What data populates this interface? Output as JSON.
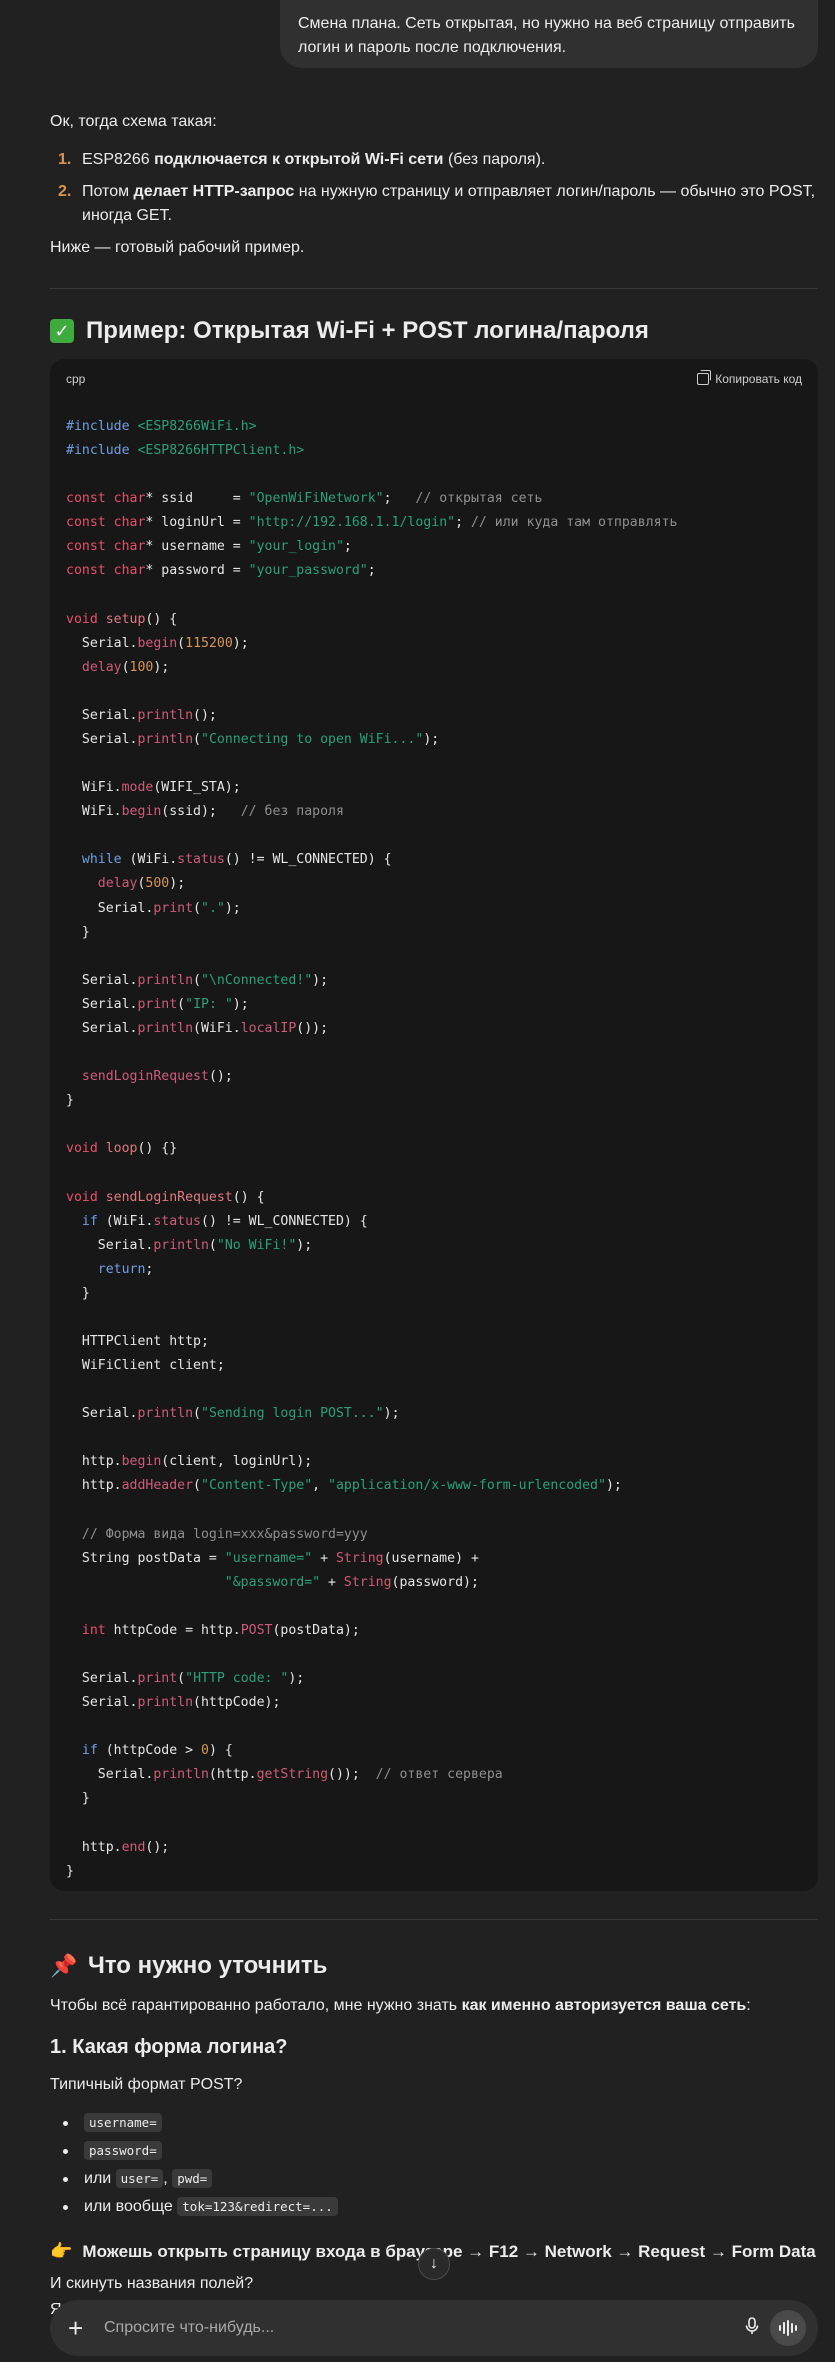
{
  "user_message": "Смена плана. Сеть открытая, но нужно на веб страницу отправить логин и пароль после подключения.",
  "answer": {
    "intro": "Ок, тогда схема такая:",
    "steps": [
      {
        "num": "1.",
        "pre": "ESP8266 ",
        "bold": "подключается к открытой Wi-Fi сети",
        "post": " (без пароля)."
      },
      {
        "num": "2.",
        "pre": "Потом ",
        "bold": "делает HTTP-запрос",
        "post": " на нужную страницу и отправляет логин/пароль — обычно это POST, иногда GET."
      }
    ],
    "below": "Ниже — готовый рабочий пример.",
    "section1_title": "Пример: Открытая Wi-Fi + POST логина/пароля",
    "code": {
      "lang": "cpp",
      "copy_label": "Копировать код"
    },
    "section2_title": "Что нужно уточнить",
    "clarify_pre": "Чтобы всё гарантированно работало, мне нужно знать ",
    "clarify_bold": "как именно авторизуется ваша сеть",
    "clarify_post": ":",
    "q1_title": "1. Какая форма логина?",
    "q1_text": "Типичный формат POST?",
    "bullets": {
      "b1": "username=",
      "b2": "password=",
      "b3_pre": "или ",
      "b3_code1": "user=",
      "b3_sep": ", ",
      "b3_code2": "pwd=",
      "b4_pre": "или вообще ",
      "b4_code": "tok=123&redirect=..."
    },
    "point_line": "Можешь открыть страницу входа в браузере → F12 → Network → Request → Form Data",
    "ask_names": "И скинуть названия полей?",
    "trailing": "Я"
  },
  "composer": {
    "placeholder": "Спросите что-нибудь..."
  },
  "icons": {
    "check": "check-mark-emoji-icon",
    "pin": "pushpin-emoji-icon",
    "hand": "pointing-hand-emoji-icon",
    "copy": "copy-icon",
    "plus": "plus-icon",
    "mic": "microphone-icon",
    "voice": "voice-mode-icon",
    "scroll": "arrow-down-icon"
  }
}
